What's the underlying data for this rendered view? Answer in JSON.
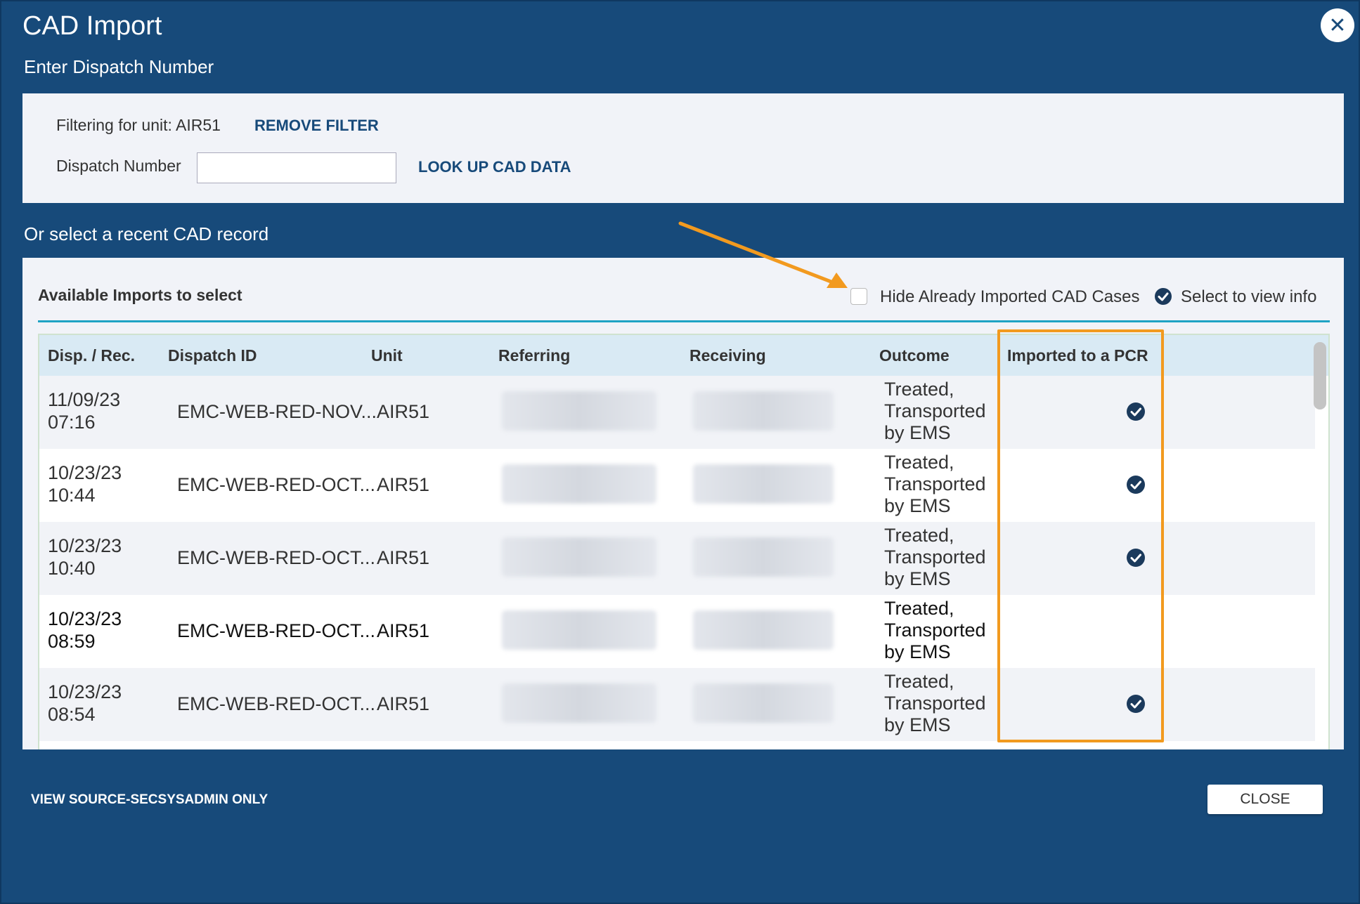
{
  "dialog": {
    "title": "CAD Import",
    "close_icon": "close-icon",
    "enter_dispatch_label": "Enter Dispatch Number",
    "or_select_label": "Or select a recent CAD record"
  },
  "filter": {
    "filter_text": "Filtering for unit: AIR51",
    "remove_filter": "REMOVE FILTER",
    "dispatch_label": "Dispatch Number",
    "dispatch_value": "",
    "lookup_button": "LOOK UP CAD DATA"
  },
  "records": {
    "title": "Available Imports to select",
    "hide_imported_label": "Hide Already Imported CAD Cases",
    "hide_imported_checked": false,
    "select_to_view_label": "Select to view info",
    "columns": [
      "Disp. / Rec.",
      "Dispatch ID",
      "Unit",
      "Referring",
      "Receiving",
      "Outcome",
      "Imported to a PCR"
    ],
    "rows": [
      {
        "date": "11/09/23",
        "time": "07:16",
        "dispatch_id": "EMC-WEB-RED-NOV...",
        "unit": "AIR51",
        "outcome_1": "Treated,",
        "outcome_2": "Transported",
        "outcome_3": "by EMS",
        "imported": true
      },
      {
        "date": "10/23/23",
        "time": "10:44",
        "dispatch_id": "EMC-WEB-RED-OCT...",
        "unit": "AIR51",
        "outcome_1": "Treated,",
        "outcome_2": "Transported",
        "outcome_3": "by EMS",
        "imported": true
      },
      {
        "date": "10/23/23",
        "time": "10:40",
        "dispatch_id": "EMC-WEB-RED-OCT...",
        "unit": "AIR51",
        "outcome_1": "Treated,",
        "outcome_2": "Transported",
        "outcome_3": "by EMS",
        "imported": true
      },
      {
        "date": "10/23/23",
        "time": "08:59",
        "dispatch_id": "EMC-WEB-RED-OCT...",
        "unit": "AIR51",
        "outcome_1": "Treated,",
        "outcome_2": "Transported",
        "outcome_3": "by EMS",
        "imported": false
      },
      {
        "date": "10/23/23",
        "time": "08:54",
        "dispatch_id": "EMC-WEB-RED-OCT...",
        "unit": "AIR51",
        "outcome_1": "Treated,",
        "outcome_2": "Transported",
        "outcome_3": "by EMS",
        "imported": true
      }
    ]
  },
  "footer": {
    "view_source": "VIEW SOURCE-SECSYSADMIN ONLY",
    "close_button": "CLOSE"
  },
  "colors": {
    "background": "#174a7a",
    "panel": "#f1f3f8",
    "header_row": "#d9eaf4",
    "accent_rule": "#1fa3c4",
    "highlight": "#f29a1f",
    "link": "#174a7a"
  }
}
